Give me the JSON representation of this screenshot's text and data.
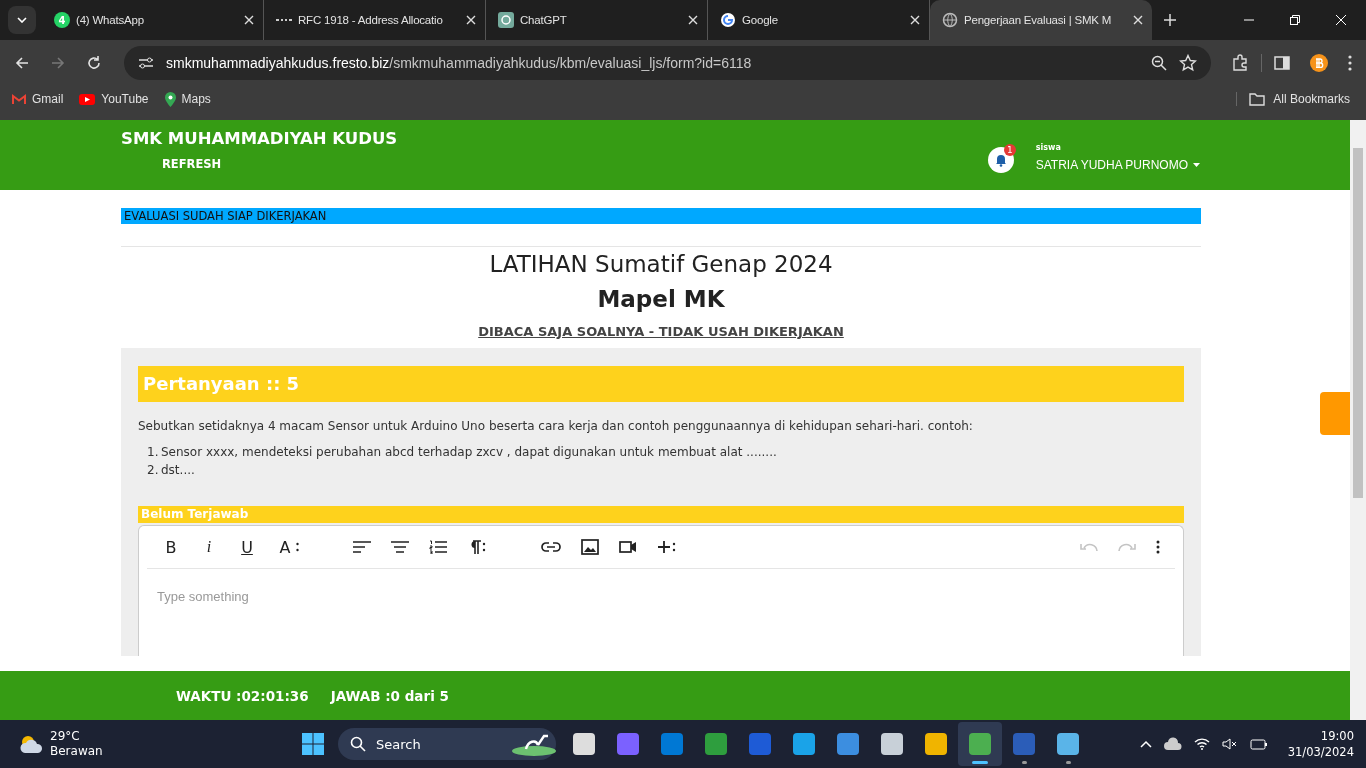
{
  "browser": {
    "tabs": [
      {
        "title": "(4) WhatsApp",
        "selected": false
      },
      {
        "title": "RFC 1918 - Address Allocatio",
        "selected": false
      },
      {
        "title": "ChatGPT",
        "selected": false
      },
      {
        "title": "Google",
        "selected": false
      },
      {
        "title": "Pengerjaan Evaluasi | SMK M",
        "selected": true
      }
    ],
    "whatsapp_badge": "4",
    "url_host": "smkmuhammadiyahkudus.fresto.biz",
    "url_path": "/smkmuhammadiyahkudus/kbm/evaluasi_ljs/form?id=6118",
    "bookmarks": [
      "Gmail",
      "YouTube",
      "Maps"
    ],
    "all_bookmarks": "All Bookmarks"
  },
  "header": {
    "school": "SMK MUHAMMADIYAH KUDUS",
    "refresh": "REFRESH",
    "notification_count": "1",
    "role": "siswa",
    "user": "SATRIA YUDHA PURNOMO"
  },
  "status_banner": "EVALUASI SUDAH SIAP DIKERJAKAN",
  "title": "LATIHAN Sumatif Genap 2024",
  "subject": "Mapel MK",
  "note": "DIBACA SAJA SOALNYA - TIDAK USAH DIKERJAKAN",
  "question": {
    "heading": "Pertanyaan :: 5",
    "text": "Sebutkan setidaknya 4 macam Sensor untuk Arduino Uno beserta cara kerja dan contoh penggunaannya di kehidupan sehari-hari. contoh:",
    "items": [
      {
        "marker": "1.",
        "text": "Sensor xxxx, mendeteksi perubahan abcd terhadap zxcv , dapat digunakan untuk membuat alat ........"
      },
      {
        "marker": "2.",
        "text": "dst...."
      }
    ],
    "answer_status": "Belum Terjawab"
  },
  "editor": {
    "format_buttons": [
      "B",
      "i",
      "U",
      "A"
    ],
    "undo_disabled": true,
    "redo_disabled": true,
    "placeholder": "Type something"
  },
  "footer": {
    "time": "WAKTU :02:01:36",
    "answered": "JAWAB :0 dari 5"
  },
  "taskbar": {
    "temperature": "29°C",
    "weather": "Berawan",
    "search": "Search",
    "time": "19:00",
    "date": "31/03/2024",
    "apps": [
      {
        "selected": false,
        "running": false
      },
      {
        "selected": false,
        "running": false
      },
      {
        "selected": false,
        "running": false
      },
      {
        "selected": false,
        "running": false
      },
      {
        "selected": false,
        "running": false
      },
      {
        "selected": false,
        "running": false
      },
      {
        "selected": false,
        "running": false
      },
      {
        "selected": false,
        "running": false
      },
      {
        "selected": false,
        "running": false
      },
      {
        "selected": true,
        "running": true
      },
      {
        "selected": false,
        "running": true
      },
      {
        "selected": false,
        "running": true
      }
    ]
  }
}
